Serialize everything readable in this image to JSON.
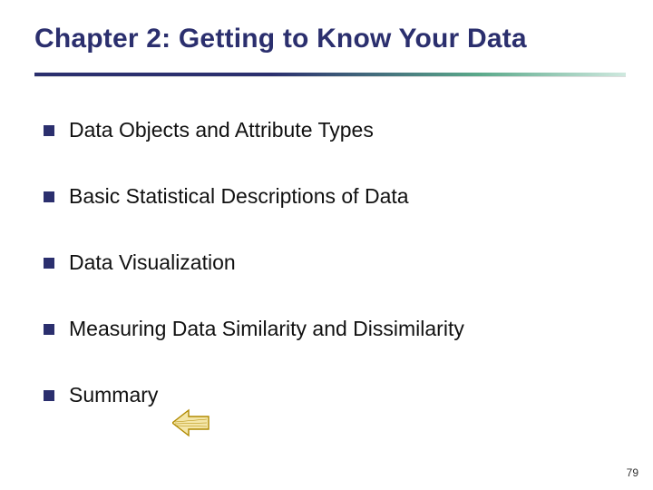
{
  "title": "Chapter 2: Getting to Know Your Data",
  "items": [
    {
      "label": "Data Objects and Attribute Types"
    },
    {
      "label": "Basic Statistical Descriptions of Data"
    },
    {
      "label": "Data Visualization"
    },
    {
      "label": "Measuring Data Similarity and Dissimilarity"
    },
    {
      "label": "Summary"
    }
  ],
  "page_number": "79",
  "colors": {
    "accent": "#2b2f6e",
    "arrow_fill": "#f4e6a8",
    "arrow_stroke": "#b08a00"
  }
}
